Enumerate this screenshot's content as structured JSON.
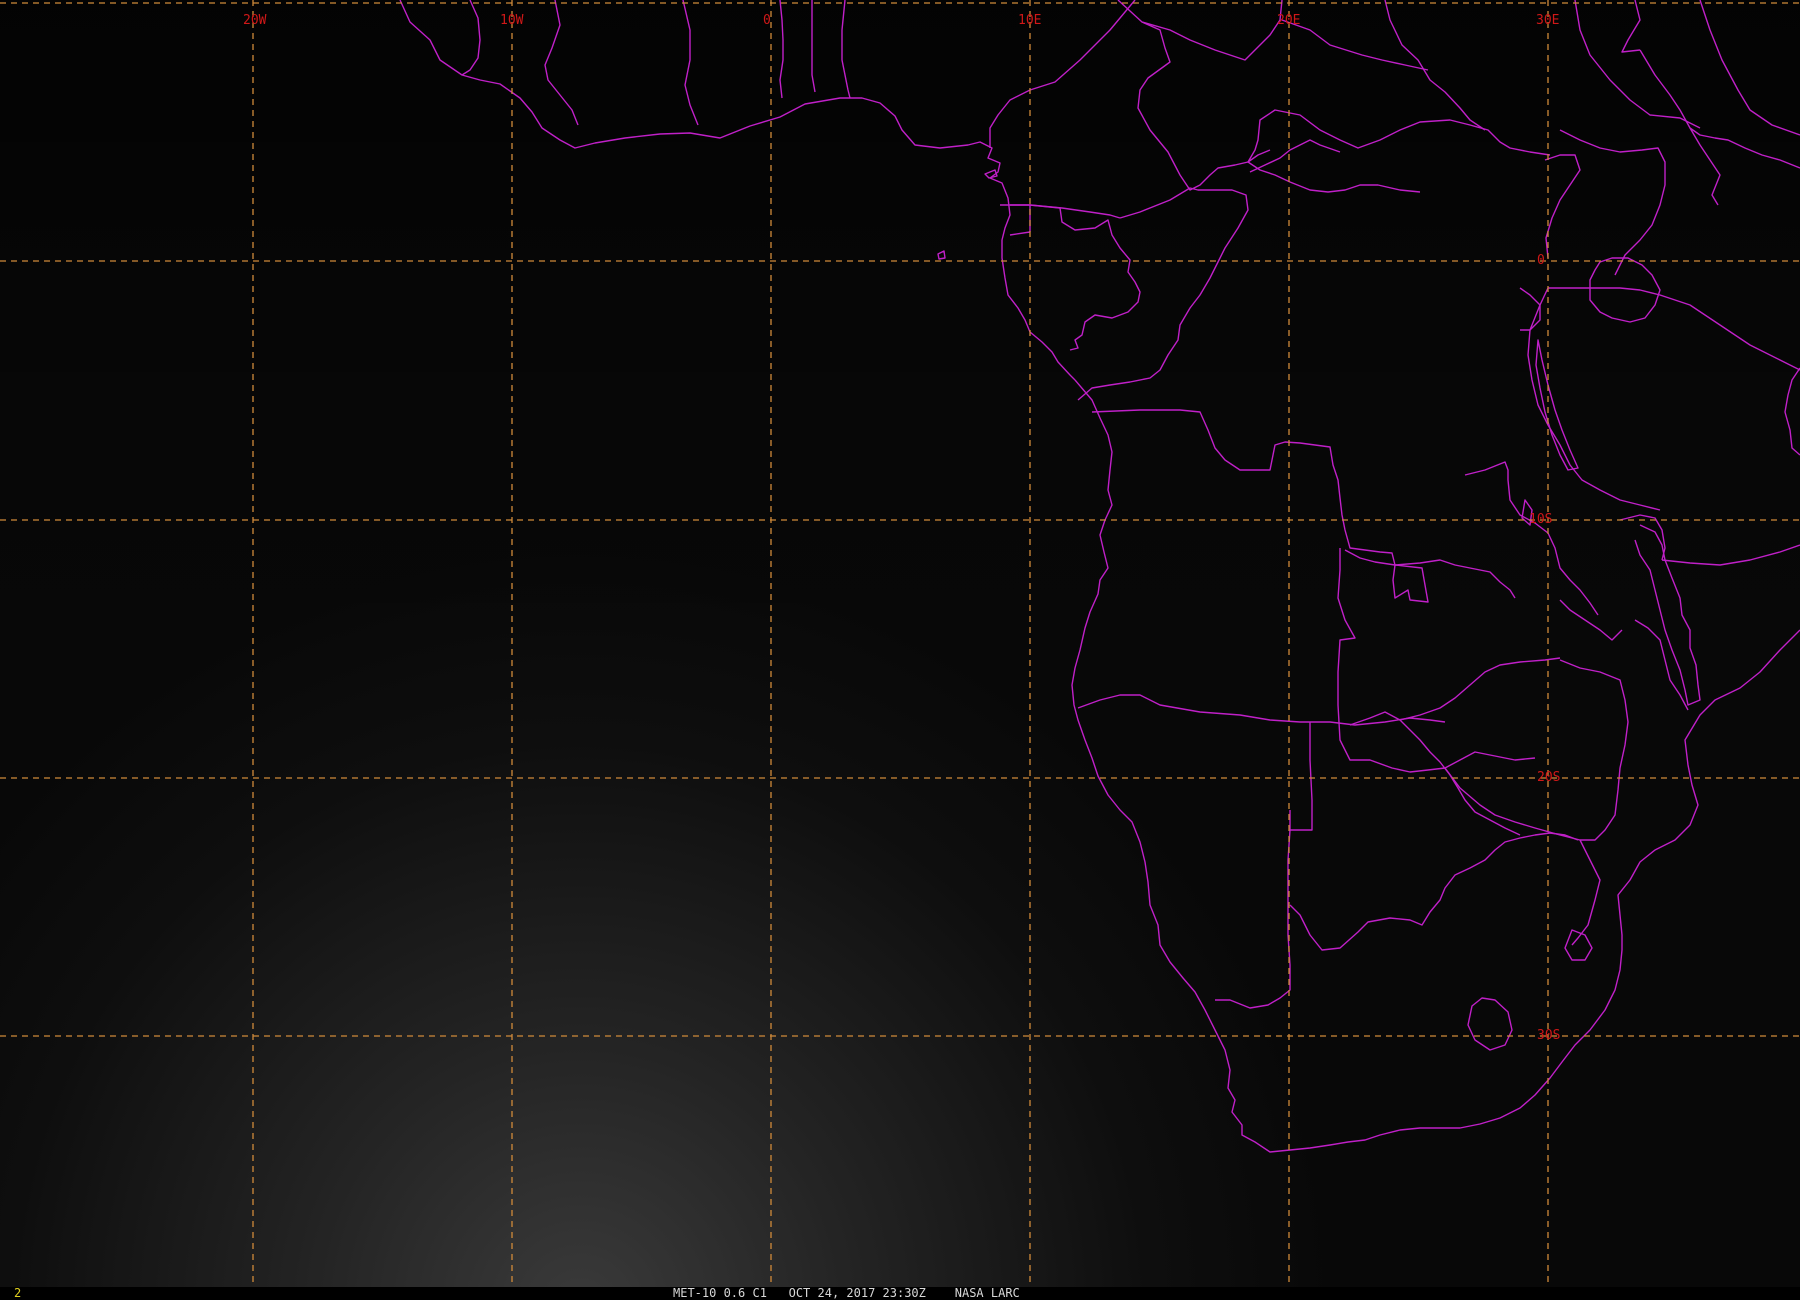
{
  "image": {
    "frame_number": "2",
    "caption": "MET-10 0.6 C1   OCT 24, 2017 23:30Z    NASA LARC"
  },
  "graticule": {
    "longitude_labels": [
      "20W",
      "10W",
      "0",
      "10E",
      "20E",
      "30E"
    ],
    "latitude_labels": [
      "0",
      "10S",
      "20S",
      "30S"
    ]
  },
  "colors": {
    "background": "#000000",
    "borders": "#c020c8",
    "gridlines": "#d08a3a",
    "grid_labels": "#d01818",
    "frame_number": "#e0d020",
    "caption": "#d8d8d8"
  }
}
